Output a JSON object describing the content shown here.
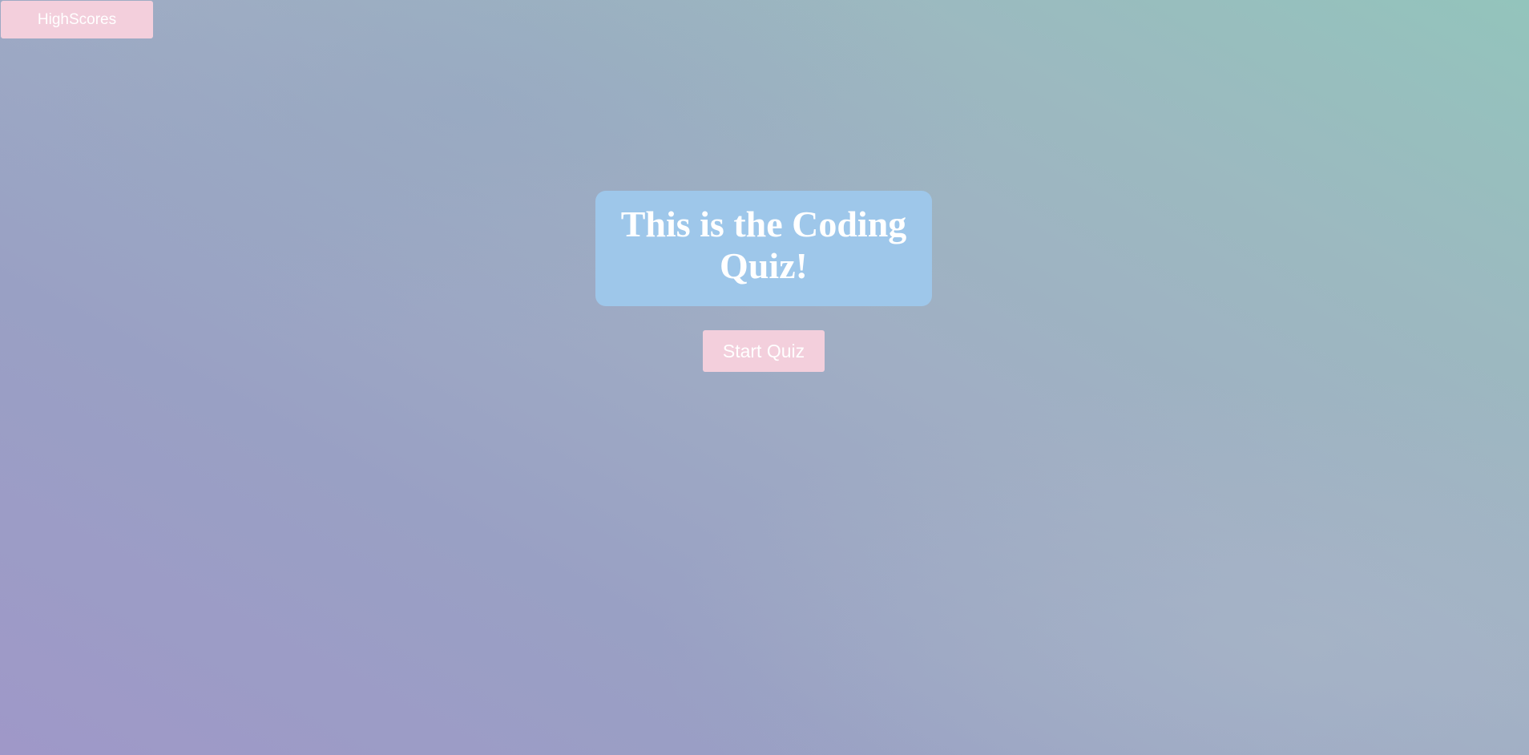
{
  "header": {
    "highscores_label": "HighScores"
  },
  "main": {
    "title": "This is the Coding Quiz!",
    "start_label": "Start Quiz"
  },
  "colors": {
    "button_bg": "#f3cfdc",
    "card_bg": "#9ec7ea",
    "text": "#ffffff",
    "background_start": "#9f98c8",
    "background_end": "#93c4bc"
  }
}
